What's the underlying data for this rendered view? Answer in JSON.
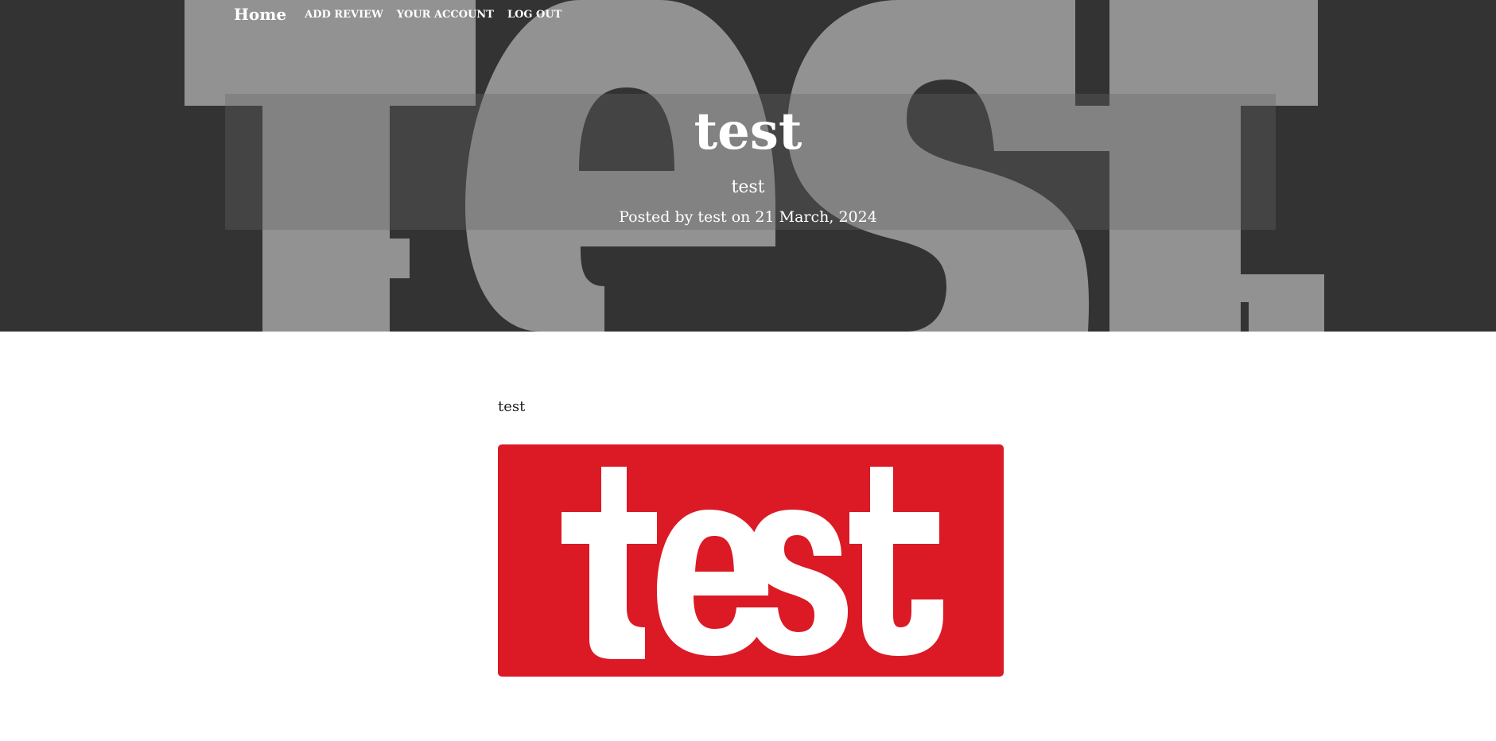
{
  "nav": {
    "brand": "Home",
    "links": [
      "ADD REVIEW",
      "YOUR ACCOUNT",
      "LOG OUT"
    ]
  },
  "hero": {
    "title": "test",
    "subtitle": "test",
    "meta": "Posted by test on 21 March, 2024",
    "background_color": "#333333",
    "background_word": "test."
  },
  "post": {
    "body_text": "test",
    "image_word": "test",
    "image_color": "#db1a25"
  }
}
